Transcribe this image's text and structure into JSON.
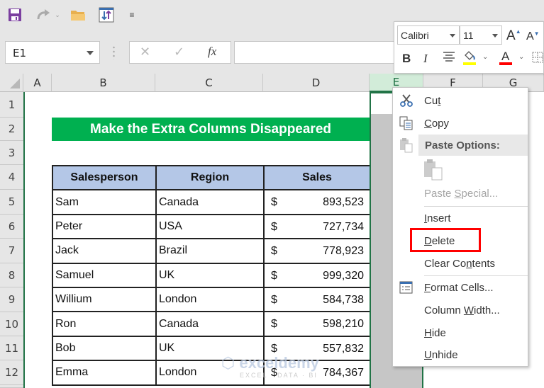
{
  "qat": {
    "icons": [
      "save-icon",
      "redo-icon",
      "dropdown-icon",
      "open-folder-icon",
      "sort-icon",
      "customize-qat-icon"
    ]
  },
  "formula_bar": {
    "name_box": "E1",
    "cancel": "✕",
    "enter": "✓",
    "fx": "fx",
    "value": ""
  },
  "columns": [
    "A",
    "B",
    "C",
    "D",
    "E",
    "F",
    "G"
  ],
  "selected_column": "E",
  "rows": [
    "1",
    "2",
    "3",
    "4",
    "5",
    "6",
    "7",
    "8",
    "9",
    "10",
    "11",
    "12"
  ],
  "sheet": {
    "title": "Make the Extra Columns Disappeared",
    "headers": [
      "Salesperson",
      "Region",
      "Sales"
    ],
    "records": [
      {
        "name": "Sam",
        "region": "Canada",
        "currency": "$",
        "sales": "893,523"
      },
      {
        "name": "Peter",
        "region": "USA",
        "currency": "$",
        "sales": "727,734"
      },
      {
        "name": "Jack",
        "region": "Brazil",
        "currency": "$",
        "sales": "778,923"
      },
      {
        "name": "Samuel",
        "region": "UK",
        "currency": "$",
        "sales": "999,320"
      },
      {
        "name": "Willium",
        "region": "London",
        "currency": "$",
        "sales": "584,738"
      },
      {
        "name": "Ron",
        "region": "Canada",
        "currency": "$",
        "sales": "598,210"
      },
      {
        "name": "Bob",
        "region": "UK",
        "currency": "$",
        "sales": "557,832"
      },
      {
        "name": "Emma",
        "region": "London",
        "currency": "$",
        "sales": "784,367"
      }
    ]
  },
  "mini_toolbar": {
    "font": "Calibri",
    "size": "11",
    "grow": "A",
    "shrink": "A",
    "bold": "B",
    "italic": "I",
    "font_color_letter": "A",
    "fill_color": "#ffff00",
    "font_color": "#ff0000"
  },
  "context_menu": {
    "items": [
      {
        "pre": "Cu",
        "u": "t",
        "post": "",
        "icon": "scissors-icon"
      },
      {
        "pre": "",
        "u": "C",
        "post": "opy",
        "icon": "copy-icon"
      },
      {
        "label": "Paste Options:",
        "icon": "paste-icon"
      },
      {
        "pre": "Paste ",
        "u": "S",
        "post": "pecial...",
        "disabled": true
      },
      {
        "pre": "",
        "u": "I",
        "post": "nsert"
      },
      {
        "pre": "",
        "u": "D",
        "post": "elete"
      },
      {
        "pre": "Clear Co",
        "u": "n",
        "post": "tents"
      },
      {
        "pre": "",
        "u": "F",
        "post": "ormat Cells...",
        "icon": "format-cells-icon"
      },
      {
        "pre": "Column ",
        "u": "W",
        "post": "idth..."
      },
      {
        "pre": "",
        "u": "H",
        "post": "ide"
      },
      {
        "pre": "",
        "u": "U",
        "post": "nhide"
      }
    ]
  },
  "watermark": {
    "brand": "exceldemy",
    "tagline": "EXCEL · DATA · BI"
  }
}
